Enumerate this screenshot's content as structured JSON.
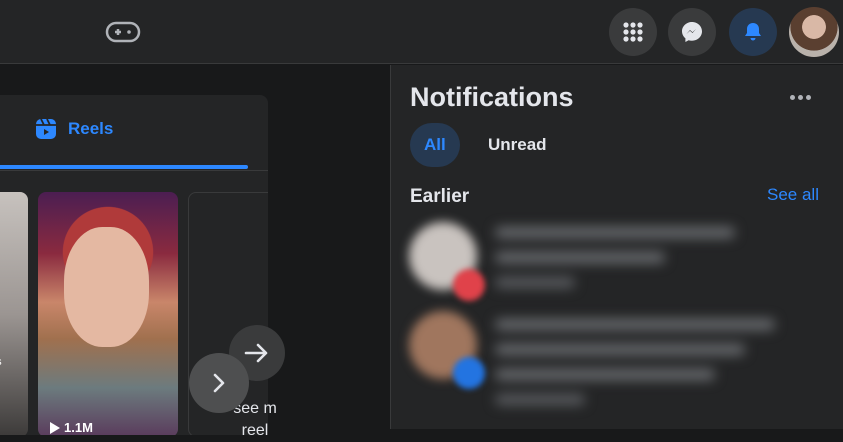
{
  "topbar": {
    "icons": {
      "game": "gamepad-icon",
      "menu": "grid-menu-icon",
      "messenger": "messenger-icon",
      "notifications": "bell-icon",
      "avatar": "profile-avatar"
    },
    "colors": {
      "accent": "#2d88ff",
      "active_bg": "#263951"
    }
  },
  "feed": {
    "reels_tab_label": "Reels",
    "reels": [
      {
        "views": ""
      },
      {
        "views": "1.1M"
      },
      {
        "see_more": "see m\nreel"
      }
    ],
    "partial_text": "us"
  },
  "notifications": {
    "title": "Notifications",
    "filters": {
      "all": "All",
      "unread": "Unread"
    },
    "section": "Earlier",
    "see_all": "See all"
  }
}
